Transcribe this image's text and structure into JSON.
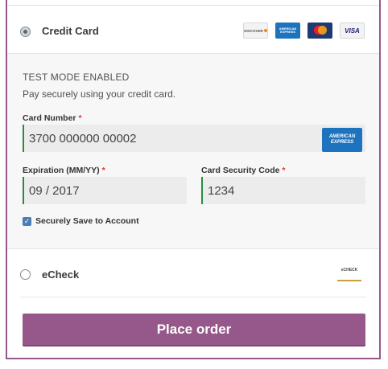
{
  "payment_methods": {
    "credit_card": {
      "label": "Credit Card",
      "selected": true,
      "card_icons": [
        "discover-icon",
        "amex-icon",
        "mastercard-icon",
        "visa-icon"
      ],
      "card_icon_text": {
        "discover": "DISCOVER",
        "amex": "AMERICAN EXPRESS",
        "visa": "VISA"
      }
    },
    "echeck": {
      "label": "eCheck",
      "selected": false,
      "logo_text": "eCHECK"
    }
  },
  "credit_card_form": {
    "test_mode": "TEST MODE ENABLED",
    "description": "Pay securely using your credit card.",
    "card_number": {
      "label": "Card Number",
      "required_mark": "*",
      "value": "3700 000000 00002",
      "card_type_badge": "AMERICAN EXPRESS"
    },
    "expiration": {
      "label": "Expiration (MM/YY)",
      "required_mark": "*",
      "value": "09 / 2017"
    },
    "security_code": {
      "label": "Card Security Code",
      "required_mark": "*",
      "value": "1234"
    },
    "save_to_account": {
      "label": "Securely Save to Account",
      "checked": true
    }
  },
  "place_order": {
    "label": "Place order"
  },
  "colors": {
    "accent": "#96588a",
    "field_border": "#2a8c3f",
    "amex_blue": "#1e73be"
  }
}
